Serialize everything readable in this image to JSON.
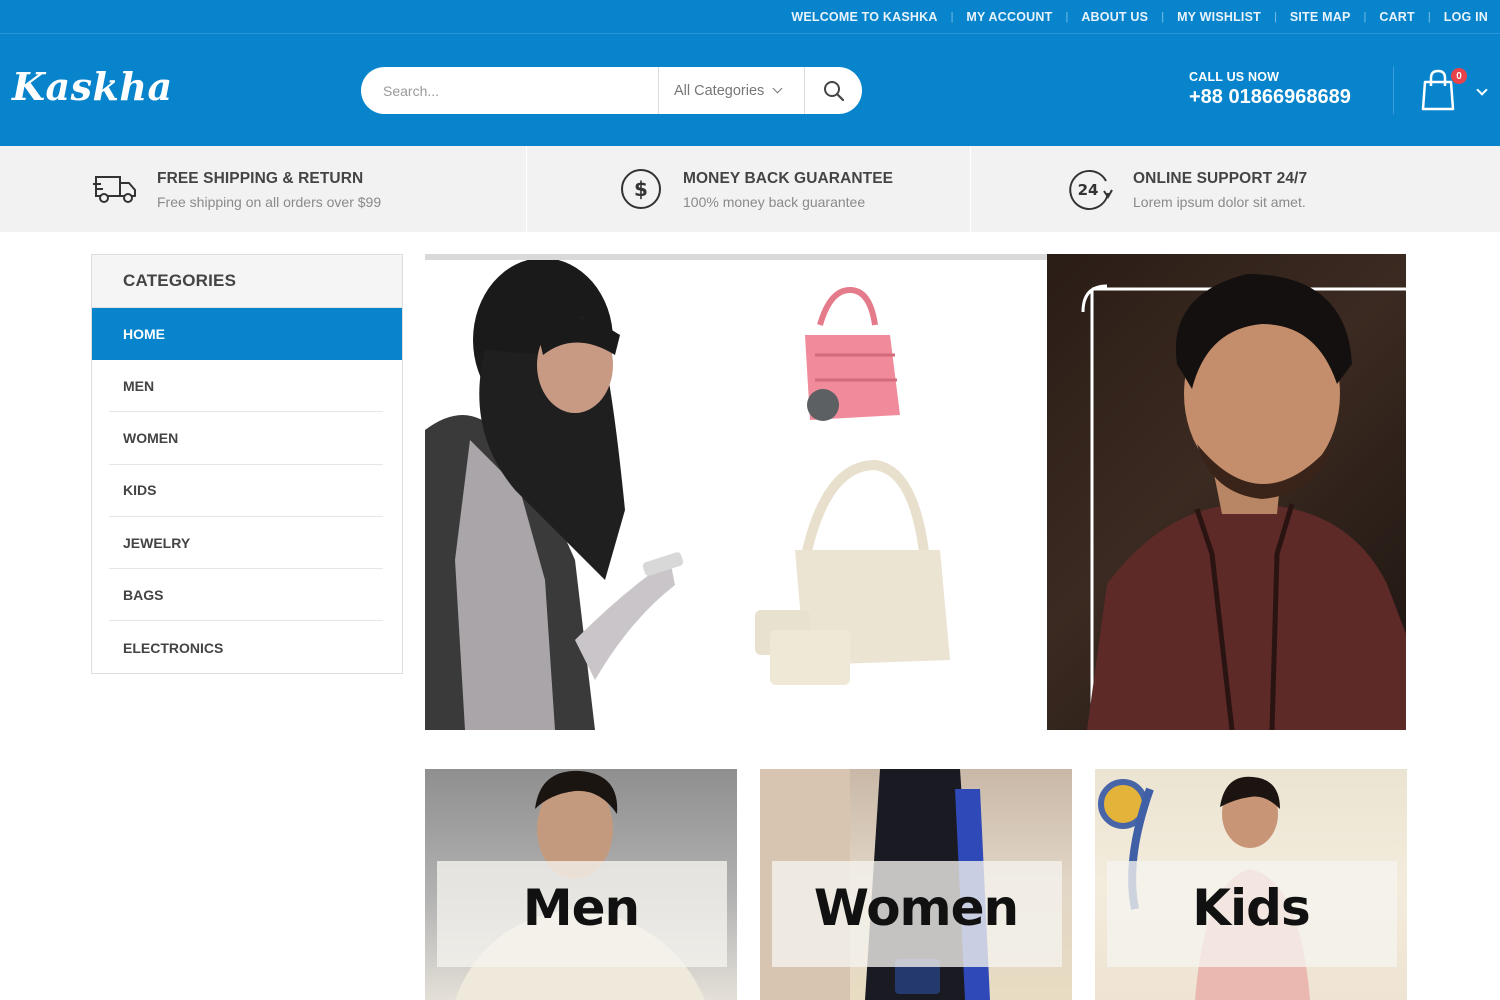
{
  "topbar": {
    "links": [
      "WELCOME TO KASHKA",
      "MY ACCOUNT",
      "ABOUT US",
      "MY WISHLIST",
      "SITE MAP",
      "CART",
      "LOG IN"
    ]
  },
  "header": {
    "logo": "Kaskha",
    "search": {
      "placeholder": "Search...",
      "category": "All Categories"
    },
    "call_label": "CALL US NOW",
    "phone": "+88 01866968689",
    "cart_count": "0"
  },
  "features": [
    {
      "icon": "truck-icon",
      "title": "FREE SHIPPING & RETURN",
      "subtitle": "Free shipping on all orders over $99"
    },
    {
      "icon": "dollar-icon",
      "title": "MONEY BACK GUARANTEE",
      "subtitle": "100% money back guarantee"
    },
    {
      "icon": "support-24-icon",
      "title": "ONLINE SUPPORT 24/7",
      "subtitle": "Lorem ipsum dolor sit amet."
    }
  ],
  "categories": {
    "title": "CATEGORIES",
    "items": [
      "HOME",
      "MEN",
      "WOMEN",
      "KIDS",
      "JEWELRY",
      "BAGS",
      "ELECTRONICS"
    ],
    "active": "HOME"
  },
  "tiles": [
    "Men",
    "Women",
    "Kids"
  ],
  "colors": {
    "brand": "#0784cc",
    "badge": "#e8434a"
  }
}
